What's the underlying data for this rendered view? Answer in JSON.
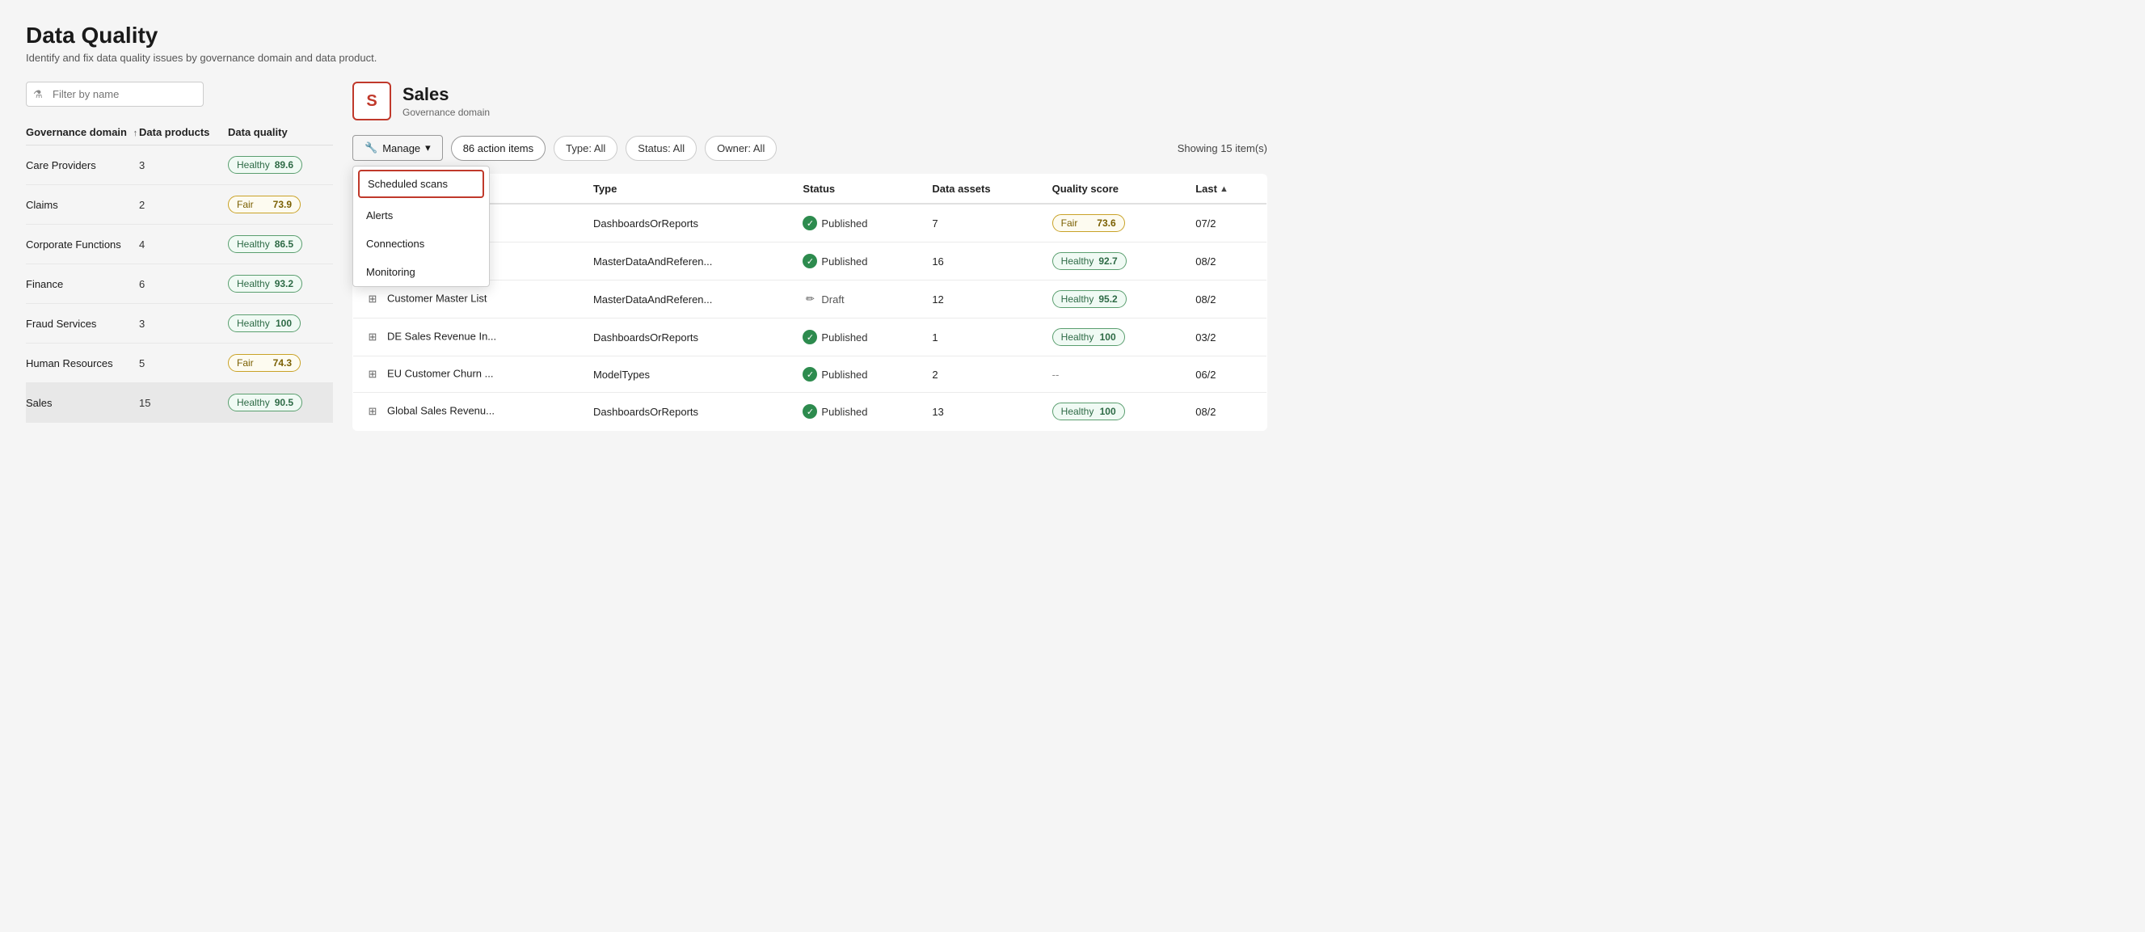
{
  "page": {
    "title": "Data Quality",
    "subtitle": "Identify and fix data quality issues by governance domain and data product.",
    "filter_placeholder": "Filter by name"
  },
  "left_table": {
    "col_domain": "Governance domain",
    "col_products": "Data products",
    "col_quality": "Data quality",
    "rows": [
      {
        "name": "Care Providers",
        "products": "3",
        "status": "Healthy",
        "score": "89.6",
        "type": "healthy"
      },
      {
        "name": "Claims",
        "products": "2",
        "status": "Fair",
        "score": "73.9",
        "type": "fair"
      },
      {
        "name": "Corporate Functions",
        "products": "4",
        "status": "Healthy",
        "score": "86.5",
        "type": "healthy"
      },
      {
        "name": "Finance",
        "products": "6",
        "status": "Healthy",
        "score": "93.2",
        "type": "healthy"
      },
      {
        "name": "Fraud Services",
        "products": "3",
        "status": "Healthy",
        "score": "100",
        "type": "healthy"
      },
      {
        "name": "Human Resources",
        "products": "5",
        "status": "Fair",
        "score": "74.3",
        "type": "fair"
      },
      {
        "name": "Sales",
        "products": "15",
        "status": "Healthy",
        "score": "90.5",
        "type": "healthy",
        "selected": true
      }
    ]
  },
  "right_panel": {
    "domain_letter": "S",
    "domain_name": "Sales",
    "domain_type": "Governance domain",
    "toolbar": {
      "manage_label": "Manage",
      "action_items_label": "86 action items",
      "type_filter": "Type: All",
      "status_filter": "Status: All",
      "owner_filter": "Owner: All",
      "showing_text": "Showing 15 item(s)"
    },
    "dropdown": {
      "items": [
        {
          "label": "Scheduled scans",
          "highlighted": true
        },
        {
          "label": "Alerts",
          "highlighted": false
        },
        {
          "label": "Connections",
          "highlighted": false
        },
        {
          "label": "Monitoring",
          "highlighted": false
        }
      ]
    },
    "table": {
      "columns": [
        "",
        "Type",
        "Status",
        "Data assets",
        "Quality score",
        "Last"
      ],
      "rows": [
        {
          "name": "",
          "type": "DashboardsOrReports",
          "status": "Published",
          "status_type": "published",
          "assets": "7",
          "quality_label": "Fair",
          "quality_score": "73.6",
          "quality_type": "fair",
          "last": "07/2"
        },
        {
          "name": "",
          "type": "MasterDataAndReferen...",
          "status": "Published",
          "status_type": "published",
          "assets": "16",
          "quality_label": "Healthy",
          "quality_score": "92.7",
          "quality_type": "healthy",
          "last": "08/2"
        },
        {
          "name": "Customer Master List",
          "type": "MasterDataAndReferen...",
          "status": "Draft",
          "status_type": "draft",
          "assets": "12",
          "quality_label": "Healthy",
          "quality_score": "95.2",
          "quality_type": "healthy",
          "last": "08/2"
        },
        {
          "name": "DE Sales Revenue In...",
          "type": "DashboardsOrReports",
          "status": "Published",
          "status_type": "published",
          "assets": "1",
          "quality_label": "Healthy",
          "quality_score": "100",
          "quality_type": "healthy",
          "last": "03/2"
        },
        {
          "name": "EU Customer Churn ...",
          "type": "ModelTypes",
          "status": "Published",
          "status_type": "published",
          "assets": "2",
          "quality_label": "--",
          "quality_score": "",
          "quality_type": "none",
          "last": "06/2"
        },
        {
          "name": "Global Sales Revenu...",
          "type": "DashboardsOrReports",
          "status": "Published",
          "status_type": "published",
          "assets": "13",
          "quality_label": "Healthy",
          "quality_score": "100",
          "quality_type": "healthy",
          "last": "08/2"
        }
      ]
    }
  }
}
